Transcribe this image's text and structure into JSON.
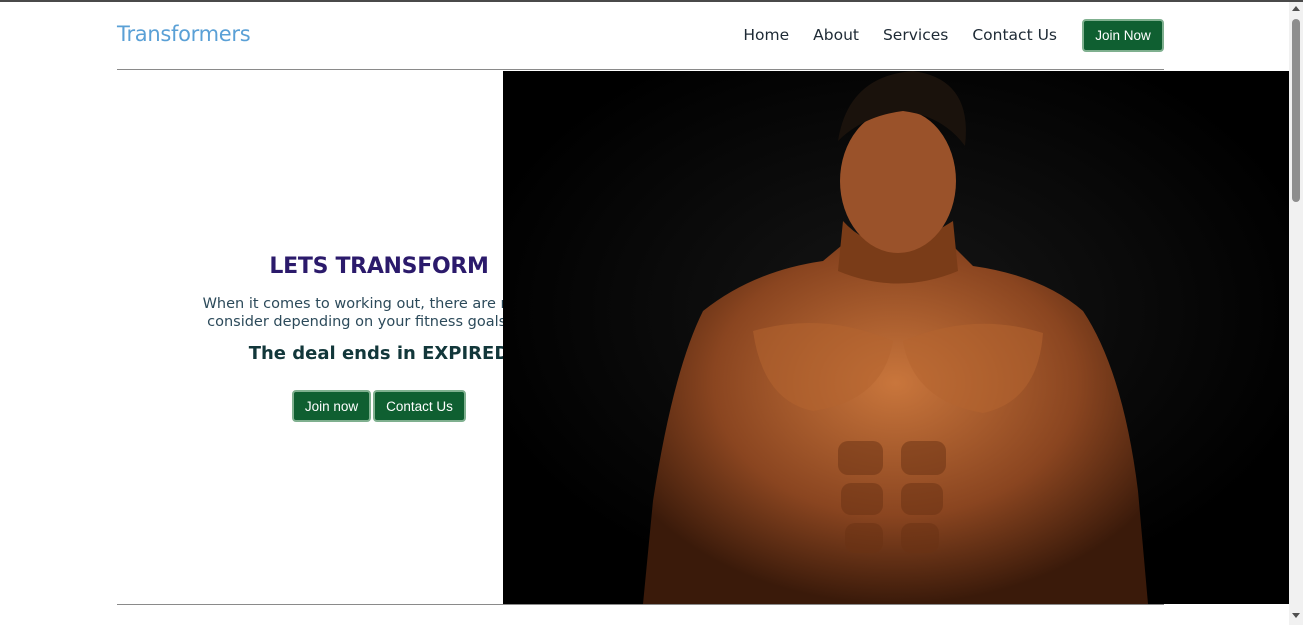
{
  "nav": {
    "brand": "Transformers",
    "links": [
      "Home",
      "About",
      "Services",
      "Contact Us"
    ],
    "join_label": "Join Now"
  },
  "hero": {
    "title": "LETS TRANSFORM",
    "description_line1": "When it comes to working out, there are numero",
    "description_line2": "consider depending on your fitness goals and p",
    "deal": "The deal ends in EXPIRED",
    "join_label": "Join now",
    "contact_label": "Contact Us"
  },
  "colors": {
    "brand": "#5aa0d6",
    "button_bg": "#0f5f31",
    "title": "#2b1a6b",
    "image_bg": "#000000"
  }
}
